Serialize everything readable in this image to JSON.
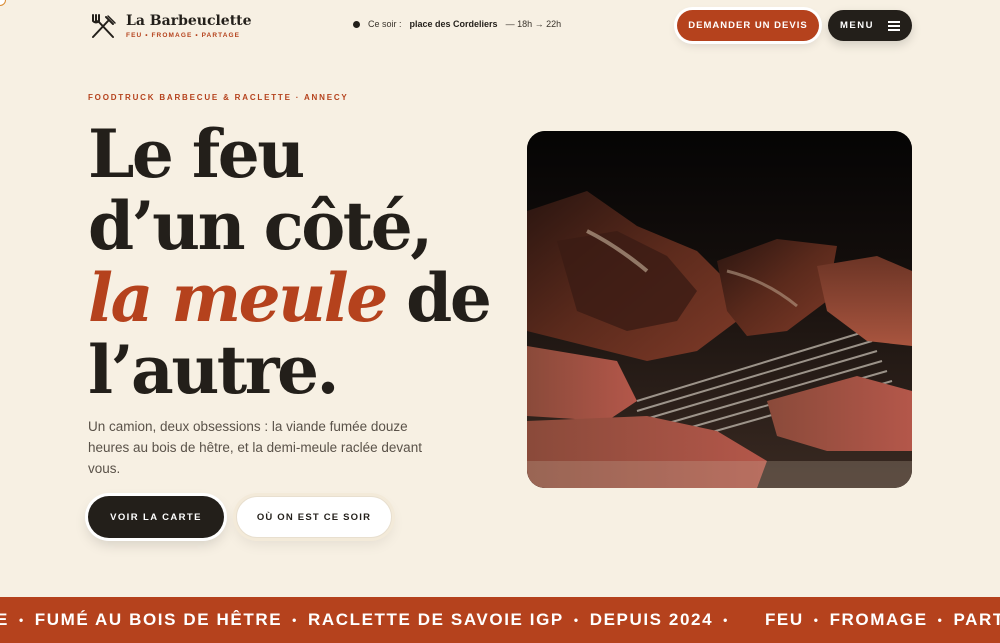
{
  "brand": {
    "name": "La Barbeuclette",
    "tagline": "FEU • FROMAGE • PARTAGE"
  },
  "tonight": {
    "label": "Ce soir :",
    "place": "place des Cordeliers",
    "hours": "— 18h → 22h"
  },
  "nav": {
    "quote_button": "DEMANDER UN DEVIS",
    "menu_button": "MENU"
  },
  "hero": {
    "eyebrow": "FOODTRUCK BARBECUE & RACLETTE · ANNECY",
    "headline_line1": "Le feu",
    "headline_line2": "d’un côté,",
    "headline_accent": "la meule",
    "headline_line3_rest": " de",
    "headline_line4": "l’autre.",
    "lede": "Un camion, deux obsessions : la viande fumée douze heures au bois de hêtre, et la demi-meule raclée devant vous.",
    "cta_primary": "VOIR LA CARTE",
    "cta_secondary": "OÙ ON EST CE SOIR"
  },
  "ticker": {
    "items": [
      "E",
      "FUMÉ AU BOIS DE HÊTRE",
      "RACLETTE DE SAVOIE IGP",
      "DEPUIS 2024",
      "FEU",
      "FROMAGE",
      "PARTAGE"
    ],
    "separator": "•"
  },
  "colors": {
    "accent": "#b5421d",
    "dark": "#231f1a",
    "background": "#f7f0e3"
  }
}
